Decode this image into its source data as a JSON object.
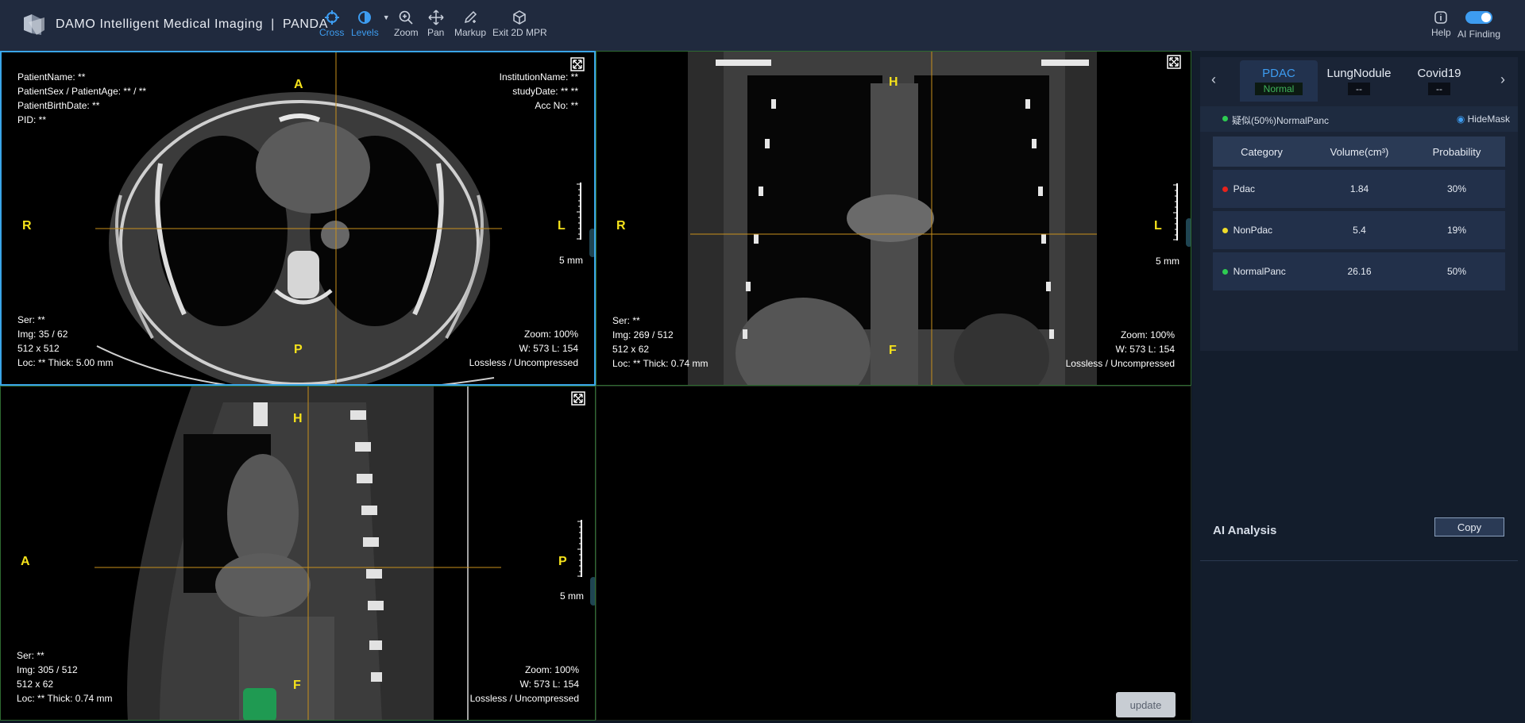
{
  "app": {
    "title": "DAMO Intelligent Medical Imaging",
    "product": "PANDA"
  },
  "toolbar": {
    "tools": [
      {
        "label": "Cross",
        "icon": "crosshair-icon",
        "active": true
      },
      {
        "label": "Levels",
        "icon": "contrast-icon",
        "active": true
      },
      {
        "label": "Zoom",
        "icon": "zoom-icon",
        "active": false
      },
      {
        "label": "Pan",
        "icon": "pan-icon",
        "active": false
      },
      {
        "label": "Markup",
        "icon": "pencil-icon",
        "active": false
      },
      {
        "label": "Exit 2D MPR",
        "icon": "cube-icon",
        "active": false
      }
    ],
    "help_label": "Help",
    "ai_finding_label": "AI Finding",
    "ai_finding_enabled": true
  },
  "viewports": {
    "axial": {
      "tl": [
        "PatientName: **",
        "PatientSex / PatientAge: ** / **",
        "PatientBirthDate: **",
        "PID: **"
      ],
      "tr": [
        "InstitutionName: **",
        "studyDate: ** **",
        "Acc No: **"
      ],
      "bl": [
        "Ser: **",
        "Img: 35 / 62",
        "512 x 512",
        "Loc: ** Thick: 5.00 mm"
      ],
      "br": [
        "Zoom: 100%",
        "W: 573 L: 154",
        "Lossless / Uncompressed"
      ],
      "orient": {
        "top": "A",
        "bottom": "P",
        "left": "R",
        "right": "L"
      },
      "scale": "5 mm"
    },
    "coronal": {
      "bl": [
        "Ser: **",
        "Img: 269 / 512",
        "512 x 62",
        "Loc: ** Thick: 0.74 mm"
      ],
      "br": [
        "Zoom: 100%",
        "W: 573 L: 154",
        "Lossless / Uncompressed"
      ],
      "orient": {
        "top": "H",
        "bottom": "F",
        "left": "R",
        "right": "L"
      },
      "scale": "5 mm"
    },
    "sagittal": {
      "bl": [
        "Ser: **",
        "Img: 305 / 512",
        "512 x 62",
        "Loc: ** Thick: 0.74 mm"
      ],
      "br": [
        "Zoom: 100%",
        "W: 573 L: 154",
        "Lossless / Uncompressed"
      ],
      "orient": {
        "top": "H",
        "bottom": "F",
        "left": "A",
        "right": "P"
      },
      "scale": "5 mm"
    },
    "update_label": "update"
  },
  "panel": {
    "tabs": [
      {
        "name": "PDAC",
        "badge": "Normal",
        "active": true
      },
      {
        "name": "LungNodule",
        "badge": "--",
        "active": false
      },
      {
        "name": "Covid19",
        "badge": "--",
        "active": false
      }
    ],
    "finding": {
      "text": "疑似(50%)NormalPanc",
      "dot_color": "#2ecc52"
    },
    "hide_mask_label": "HideMask",
    "table": {
      "headers": [
        "Category",
        "Volume(cm³)",
        "Probability"
      ],
      "rows": [
        {
          "category": "Pdac",
          "volume": "1.84",
          "probability": "30%",
          "color": "#e8221b"
        },
        {
          "category": "NonPdac",
          "volume": "5.4",
          "probability": "19%",
          "color": "#f0dc2a"
        },
        {
          "category": "NormalPanc",
          "volume": "26.16",
          "probability": "50%",
          "color": "#2ecc52"
        }
      ]
    },
    "ai_analysis_label": "AI Analysis",
    "copy_label": "Copy"
  }
}
